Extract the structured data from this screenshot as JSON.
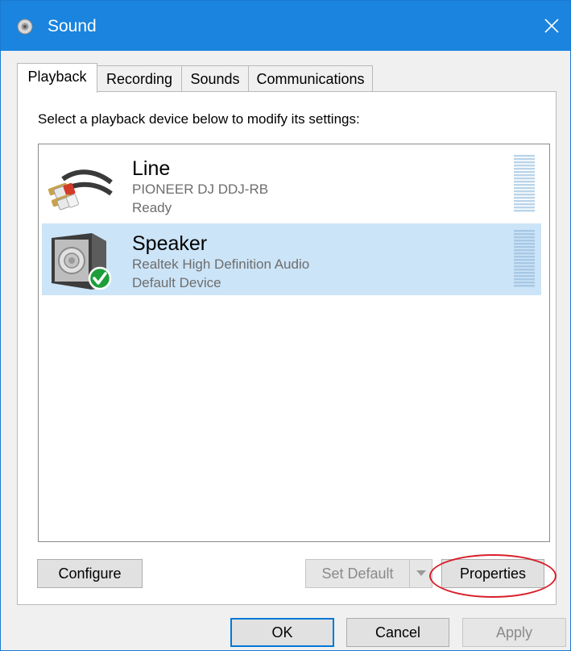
{
  "window": {
    "title": "Sound",
    "close_label": "✕"
  },
  "tabs": [
    {
      "label": "Playback",
      "active": true
    },
    {
      "label": "Recording",
      "active": false
    },
    {
      "label": "Sounds",
      "active": false
    },
    {
      "label": "Communications",
      "active": false
    }
  ],
  "panel": {
    "instruction": "Select a playback device below to modify its settings:"
  },
  "devices": [
    {
      "name": "Line",
      "description": "PIONEER DJ DDJ-RB",
      "status": "Ready",
      "icon": "rca-cable-icon",
      "selected": false
    },
    {
      "name": "Speaker",
      "description": "Realtek High Definition Audio",
      "status": "Default Device",
      "icon": "speaker-icon",
      "selected": true
    }
  ],
  "panel_buttons": {
    "configure": "Configure",
    "set_default": "Set Default",
    "properties": "Properties"
  },
  "dialog_buttons": {
    "ok": "OK",
    "cancel": "Cancel",
    "apply": "Apply"
  },
  "colors": {
    "titlebar": "#1a84de",
    "selection": "#cce4f7",
    "annotation": "#d8202c",
    "default_check": "#1e9e3a"
  }
}
